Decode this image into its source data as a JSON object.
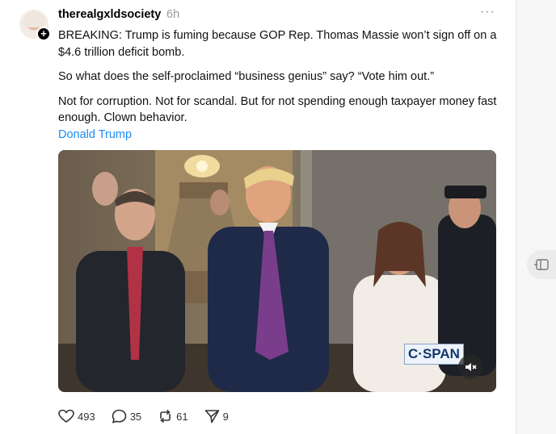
{
  "post": {
    "username": "therealgxldsociety",
    "timestamp": "6h",
    "more_label": "···",
    "follow_label": "+",
    "paragraphs": [
      "BREAKING: Trump is fuming because GOP Rep. Thomas Massie won’t sign off on a $4.6 trillion deficit bomb.",
      "So what does the self-proclaimed “business genius” say? “Vote him out.”",
      "Not for corruption. Not for scandal. But for not spending enough taxpayer money fast enough. Clown behavior."
    ],
    "tag": "Donald Trump"
  },
  "media": {
    "watermark": "C·SPAN"
  },
  "actions": {
    "likes": "493",
    "replies": "35",
    "reposts": "61",
    "shares": "9"
  },
  "icons": {
    "like": "heart-icon",
    "reply": "comment-icon",
    "repost": "repost-icon",
    "share": "send-icon",
    "mute": "muted-speaker-icon",
    "side": "panel-icon"
  },
  "colors": {
    "link": "#1d8cf0",
    "timestamp": "#999999",
    "background": "#ffffff"
  }
}
